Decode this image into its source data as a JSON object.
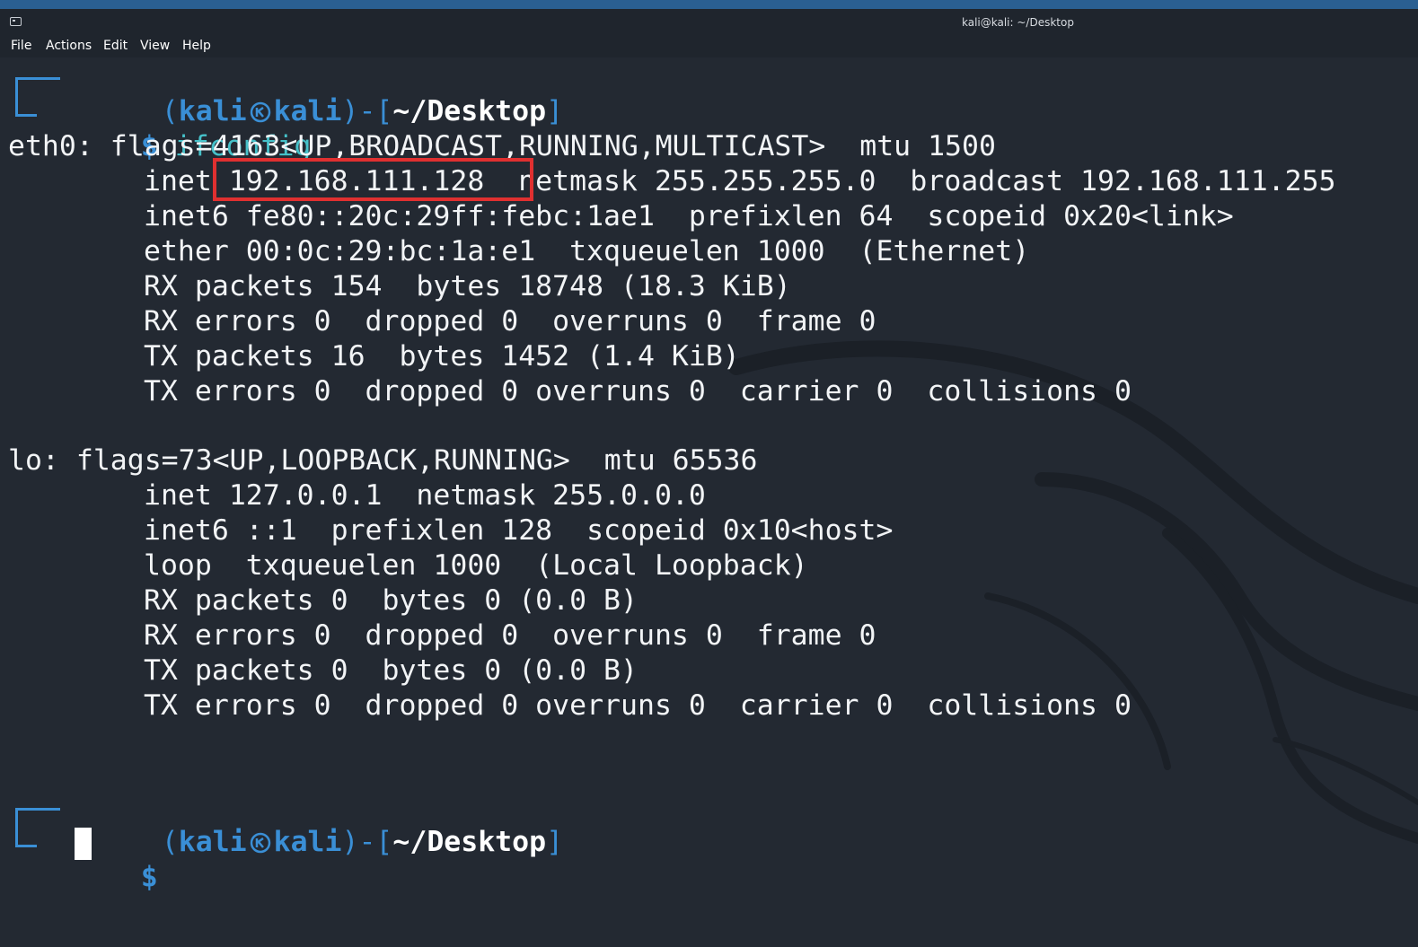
{
  "window": {
    "title": "kali@kali: ~/Desktop"
  },
  "menu": [
    "File",
    "Actions",
    "Edit",
    "View",
    "Help"
  ],
  "prompt": {
    "open_paren": "(",
    "user": "kali",
    "host": "kali",
    "close_bracket": ")-[",
    "path": "~/Desktop",
    "end_bracket": "]",
    "dollar": "$"
  },
  "command": "ifconfig",
  "output": {
    "eth0": [
      "eth0: flags=4163<UP,BROADCAST,RUNNING,MULTICAST>  mtu 1500",
      "inet 192.168.111.128  netmask 255.255.255.0  broadcast 192.168.111.255",
      "inet6 fe80::20c:29ff:febc:1ae1  prefixlen 64  scopeid 0x20<link>",
      "ether 00:0c:29:bc:1a:e1  txqueuelen 1000  (Ethernet)",
      "RX packets 154  bytes 18748 (18.3 KiB)",
      "RX errors 0  dropped 0  overruns 0  frame 0",
      "TX packets 16  bytes 1452 (1.4 KiB)",
      "TX errors 0  dropped 0 overruns 0  carrier 0  collisions 0"
    ],
    "lo": [
      "lo: flags=73<UP,LOOPBACK,RUNNING>  mtu 65536",
      "inet 127.0.0.1  netmask 255.0.0.0",
      "inet6 ::1  prefixlen 128  scopeid 0x10<host>",
      "loop  txqueuelen 1000  (Local Loopback)",
      "RX packets 0  bytes 0 (0.0 B)",
      "RX errors 0  dropped 0  overruns 0  frame 0",
      "TX packets 0  bytes 0 (0.0 B)",
      "TX errors 0  dropped 0 overruns 0  carrier 0  collisions 0"
    ]
  },
  "colors": {
    "background": "#232932",
    "prompt_blue": "#3a8fd6",
    "command_cyan": "#46c1c9",
    "highlight_red": "#e03030"
  }
}
